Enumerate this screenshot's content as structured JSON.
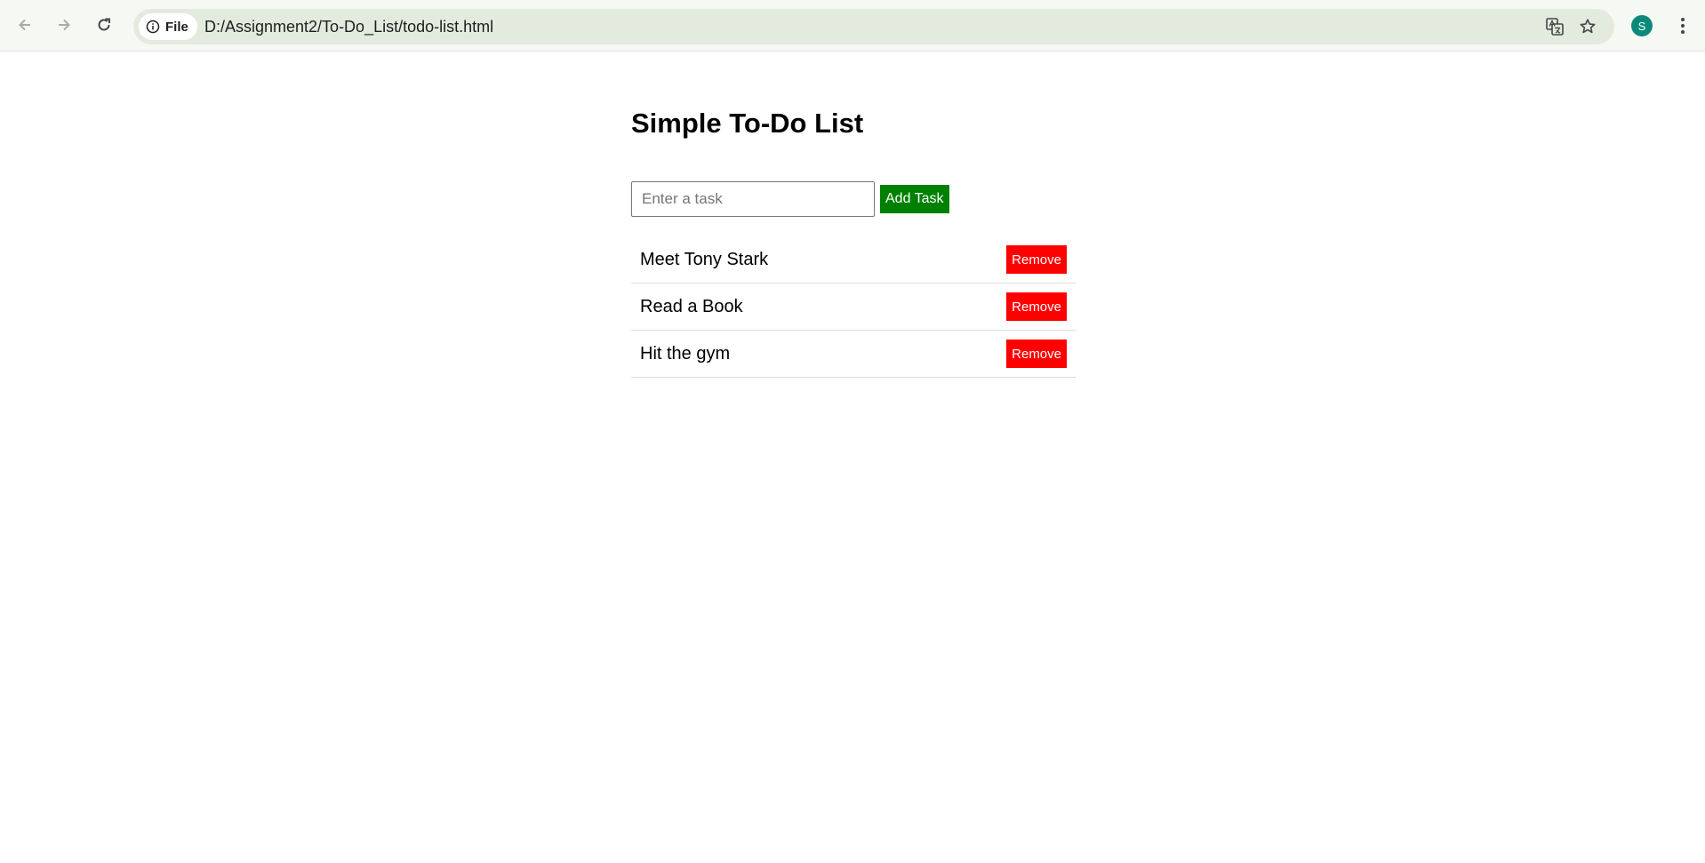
{
  "browser": {
    "back_icon": "arrow-left-icon",
    "forward_icon": "arrow-right-icon",
    "reload_icon": "reload-icon",
    "site_chip_label": "File",
    "url": "D:/Assignment2/To-Do_List/todo-list.html",
    "profile_initial": "S",
    "profile_color": "#0b8a7a"
  },
  "app": {
    "title": "Simple To-Do List",
    "input": {
      "placeholder": "Enter a task",
      "value": ""
    },
    "add_button_label": "Add Task",
    "accent_add": "#008000",
    "accent_remove": "#ff0000",
    "tasks": [
      {
        "text": "Meet Tony Stark",
        "remove_label": "Remove"
      },
      {
        "text": "Read a Book",
        "remove_label": "Remove"
      },
      {
        "text": "Hit the gym",
        "remove_label": "Remove"
      }
    ]
  }
}
